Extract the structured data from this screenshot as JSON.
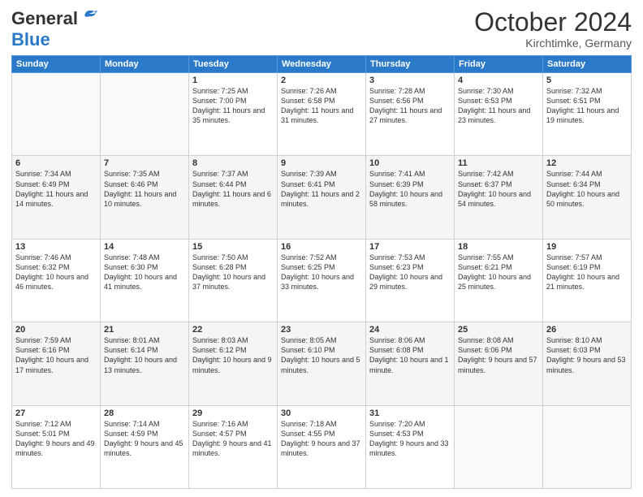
{
  "header": {
    "logo_general": "General",
    "logo_blue": "Blue",
    "month_title": "October 2024",
    "location": "Kirchtimke, Germany"
  },
  "days_of_week": [
    "Sunday",
    "Monday",
    "Tuesday",
    "Wednesday",
    "Thursday",
    "Friday",
    "Saturday"
  ],
  "weeks": [
    [
      {
        "day": "",
        "sunrise": "",
        "sunset": "",
        "daylight": ""
      },
      {
        "day": "",
        "sunrise": "",
        "sunset": "",
        "daylight": ""
      },
      {
        "day": "1",
        "sunrise": "Sunrise: 7:25 AM",
        "sunset": "Sunset: 7:00 PM",
        "daylight": "Daylight: 11 hours and 35 minutes."
      },
      {
        "day": "2",
        "sunrise": "Sunrise: 7:26 AM",
        "sunset": "Sunset: 6:58 PM",
        "daylight": "Daylight: 11 hours and 31 minutes."
      },
      {
        "day": "3",
        "sunrise": "Sunrise: 7:28 AM",
        "sunset": "Sunset: 6:56 PM",
        "daylight": "Daylight: 11 hours and 27 minutes."
      },
      {
        "day": "4",
        "sunrise": "Sunrise: 7:30 AM",
        "sunset": "Sunset: 6:53 PM",
        "daylight": "Daylight: 11 hours and 23 minutes."
      },
      {
        "day": "5",
        "sunrise": "Sunrise: 7:32 AM",
        "sunset": "Sunset: 6:51 PM",
        "daylight": "Daylight: 11 hours and 19 minutes."
      }
    ],
    [
      {
        "day": "6",
        "sunrise": "Sunrise: 7:34 AM",
        "sunset": "Sunset: 6:49 PM",
        "daylight": "Daylight: 11 hours and 14 minutes."
      },
      {
        "day": "7",
        "sunrise": "Sunrise: 7:35 AM",
        "sunset": "Sunset: 6:46 PM",
        "daylight": "Daylight: 11 hours and 10 minutes."
      },
      {
        "day": "8",
        "sunrise": "Sunrise: 7:37 AM",
        "sunset": "Sunset: 6:44 PM",
        "daylight": "Daylight: 11 hours and 6 minutes."
      },
      {
        "day": "9",
        "sunrise": "Sunrise: 7:39 AM",
        "sunset": "Sunset: 6:41 PM",
        "daylight": "Daylight: 11 hours and 2 minutes."
      },
      {
        "day": "10",
        "sunrise": "Sunrise: 7:41 AM",
        "sunset": "Sunset: 6:39 PM",
        "daylight": "Daylight: 10 hours and 58 minutes."
      },
      {
        "day": "11",
        "sunrise": "Sunrise: 7:42 AM",
        "sunset": "Sunset: 6:37 PM",
        "daylight": "Daylight: 10 hours and 54 minutes."
      },
      {
        "day": "12",
        "sunrise": "Sunrise: 7:44 AM",
        "sunset": "Sunset: 6:34 PM",
        "daylight": "Daylight: 10 hours and 50 minutes."
      }
    ],
    [
      {
        "day": "13",
        "sunrise": "Sunrise: 7:46 AM",
        "sunset": "Sunset: 6:32 PM",
        "daylight": "Daylight: 10 hours and 46 minutes."
      },
      {
        "day": "14",
        "sunrise": "Sunrise: 7:48 AM",
        "sunset": "Sunset: 6:30 PM",
        "daylight": "Daylight: 10 hours and 41 minutes."
      },
      {
        "day": "15",
        "sunrise": "Sunrise: 7:50 AM",
        "sunset": "Sunset: 6:28 PM",
        "daylight": "Daylight: 10 hours and 37 minutes."
      },
      {
        "day": "16",
        "sunrise": "Sunrise: 7:52 AM",
        "sunset": "Sunset: 6:25 PM",
        "daylight": "Daylight: 10 hours and 33 minutes."
      },
      {
        "day": "17",
        "sunrise": "Sunrise: 7:53 AM",
        "sunset": "Sunset: 6:23 PM",
        "daylight": "Daylight: 10 hours and 29 minutes."
      },
      {
        "day": "18",
        "sunrise": "Sunrise: 7:55 AM",
        "sunset": "Sunset: 6:21 PM",
        "daylight": "Daylight: 10 hours and 25 minutes."
      },
      {
        "day": "19",
        "sunrise": "Sunrise: 7:57 AM",
        "sunset": "Sunset: 6:19 PM",
        "daylight": "Daylight: 10 hours and 21 minutes."
      }
    ],
    [
      {
        "day": "20",
        "sunrise": "Sunrise: 7:59 AM",
        "sunset": "Sunset: 6:16 PM",
        "daylight": "Daylight: 10 hours and 17 minutes."
      },
      {
        "day": "21",
        "sunrise": "Sunrise: 8:01 AM",
        "sunset": "Sunset: 6:14 PM",
        "daylight": "Daylight: 10 hours and 13 minutes."
      },
      {
        "day": "22",
        "sunrise": "Sunrise: 8:03 AM",
        "sunset": "Sunset: 6:12 PM",
        "daylight": "Daylight: 10 hours and 9 minutes."
      },
      {
        "day": "23",
        "sunrise": "Sunrise: 8:05 AM",
        "sunset": "Sunset: 6:10 PM",
        "daylight": "Daylight: 10 hours and 5 minutes."
      },
      {
        "day": "24",
        "sunrise": "Sunrise: 8:06 AM",
        "sunset": "Sunset: 6:08 PM",
        "daylight": "Daylight: 10 hours and 1 minute."
      },
      {
        "day": "25",
        "sunrise": "Sunrise: 8:08 AM",
        "sunset": "Sunset: 6:06 PM",
        "daylight": "Daylight: 9 hours and 57 minutes."
      },
      {
        "day": "26",
        "sunrise": "Sunrise: 8:10 AM",
        "sunset": "Sunset: 6:03 PM",
        "daylight": "Daylight: 9 hours and 53 minutes."
      }
    ],
    [
      {
        "day": "27",
        "sunrise": "Sunrise: 7:12 AM",
        "sunset": "Sunset: 5:01 PM",
        "daylight": "Daylight: 9 hours and 49 minutes."
      },
      {
        "day": "28",
        "sunrise": "Sunrise: 7:14 AM",
        "sunset": "Sunset: 4:59 PM",
        "daylight": "Daylight: 9 hours and 45 minutes."
      },
      {
        "day": "29",
        "sunrise": "Sunrise: 7:16 AM",
        "sunset": "Sunset: 4:57 PM",
        "daylight": "Daylight: 9 hours and 41 minutes."
      },
      {
        "day": "30",
        "sunrise": "Sunrise: 7:18 AM",
        "sunset": "Sunset: 4:55 PM",
        "daylight": "Daylight: 9 hours and 37 minutes."
      },
      {
        "day": "31",
        "sunrise": "Sunrise: 7:20 AM",
        "sunset": "Sunset: 4:53 PM",
        "daylight": "Daylight: 9 hours and 33 minutes."
      },
      {
        "day": "",
        "sunrise": "",
        "sunset": "",
        "daylight": ""
      },
      {
        "day": "",
        "sunrise": "",
        "sunset": "",
        "daylight": ""
      }
    ]
  ]
}
